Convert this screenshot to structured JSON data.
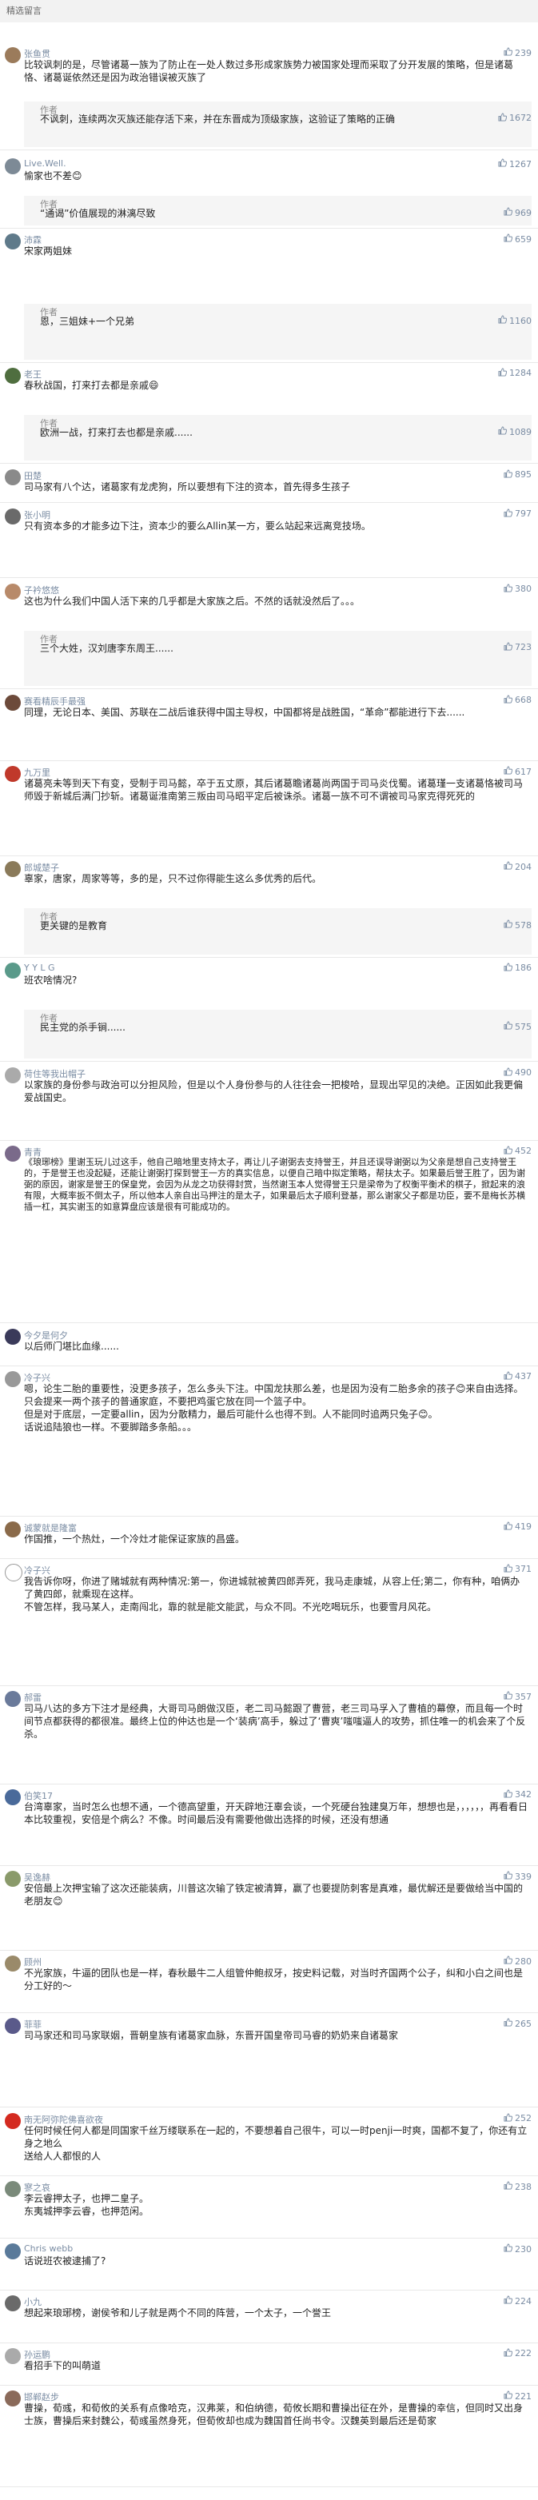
{
  "header": {
    "title": "精选留言"
  },
  "comments": [
    {
      "name": "张鱼贯",
      "likes": "239",
      "avatar_color": "#9b7b5b",
      "text": "比较讽刺的是，尽管诸葛一族为了防止在一处人数过多形成家族势力被国家处理而采取了分开发展的策略，但是诸葛恪、诸葛诞依然还是因为政治错误被灭族了",
      "reply": {
        "label": "作者",
        "text": "不讽刺，连续两次灭族还能存活下来，并在东晋成为顶级家族，这验证了策略的正确",
        "likes": "1672"
      }
    },
    {
      "name": "Live.Well.",
      "likes": "1267",
      "avatar_color": "#7d8a96",
      "text": "愉家也不差😊",
      "reply": {
        "label": "作者",
        "text": "“通谒”价值展现的淋漓尽致",
        "likes": "969"
      }
    },
    {
      "name": "沛霖",
      "likes": "659",
      "avatar_color": "#5f7a8a",
      "text": "宋家两姐妹",
      "reply": {
        "label": "作者",
        "text": "恩，三姐妹+一个兄弟",
        "likes": "1160"
      }
    },
    {
      "name": "老王",
      "likes": "1284",
      "avatar_color": "#4f6e3f",
      "text": "春秋战国，打来打去都是亲戚😄",
      "reply": {
        "label": "作者",
        "text": "欧洲一战，打来打去也都是亲戚......",
        "likes": "1089"
      }
    },
    {
      "name": "田楚",
      "likes": "895",
      "avatar_color": "#8a8a8a",
      "text": "司马家有八个达，诸葛家有龙虎狗，所以要想有下注的资本，首先得多生孩子",
      "reply": null
    },
    {
      "name": "张小明",
      "likes": "797",
      "avatar_color": "#6a6a6a",
      "text": "只有资本多的才能多边下注，资本少的要么Allin某一方，要么站起来远离竞技场。",
      "reply": null
    },
    {
      "name": "子衿悠悠",
      "likes": "380",
      "avatar_color": "#b88a6a",
      "text": "这也为什么我们中国人活下来的几乎都是大家族之后。不然的话就没然后了。。。",
      "reply": {
        "label": "作者",
        "text": "三个大姓，汉刘唐李东周王......",
        "likes": "723"
      }
    },
    {
      "name": "赛看精辰手最强",
      "likes": "668",
      "avatar_color": "#6c4a3a",
      "text": "同理，无论日本、美国、苏联在二战后谁获得中国主导权，中国都将是战胜国，“革命”都能进行下去......",
      "reply": null
    },
    {
      "name": "九万里",
      "likes": "617",
      "avatar_color": "#c0392b",
      "text": "诸葛亮未等到天下有变，受制于司马懿，卒于五丈原，其后诸葛瞻诸葛尚两国于司马炎伐蜀。诸葛瑾一支诸葛恪被司马师毁于新城后满门抄斩。诸葛诞淮南第三叛由司马昭平定后被诛杀。诸葛一族不可不谓被司马家克得死死的",
      "reply": null
    },
    {
      "name": "郎城楚子",
      "likes": "204",
      "avatar_color": "#8a7a5a",
      "text": "辜家，唐家，周家等等，多的是，只不过你得能生这么多优秀的后代。",
      "reply": {
        "label": "作者",
        "text": "更关键的是教育",
        "likes": "578"
      }
    },
    {
      "name": "Y Y L G",
      "likes": "186",
      "avatar_color": "#5a9a8a",
      "text": "班农啥情况?",
      "reply": {
        "label": "作者",
        "text": "民主党的杀手锏......",
        "likes": "575"
      }
    },
    {
      "name": "荷住等我出帽子",
      "likes": "490",
      "avatar_color": "#aaaaaa",
      "text": "以家族的身份参与政治可以分担风险，但是以个人身份参与的人往往会一把梭哈，显现出罕见的决绝。正因如此我更偏爱战国史。",
      "reply": null
    },
    {
      "name": "青青",
      "likes": "452",
      "avatar_color": "#7a6a8a",
      "text": "《琅琊榜》里谢玉玩儿过这手，他自己暗地里支持太子，再让儿子谢弼去支持誉王，并且还误导谢弼以为父亲是想自己支持誉王的，于是誉王也没起疑，还能让谢弼打探到誉王一方的真实信息，以便自己暗中拟定策略，帮扶太子。如果最后誉王胜了，因为谢弼的原因，谢家是誉王的保皇党，会因为从龙之功获得封赏，当然谢玉本人觉得誉王只是梁帝为了权衡平衡术的棋子，掀起来的浪有限，大概率扳不倒太子，所以他本人亲自出马押注的是太子，如果最后太子顺利登基，那么谢家父子都是功臣，要不是梅长苏横插一杠，其实谢玉的如意算盘应该是很有可能成功的。",
      "reply": null
    },
    {
      "name": "今夕是何夕",
      "likes": "",
      "avatar_color": "#3a3a5a",
      "text": "以后师门堪比血缘......",
      "reply": null
    },
    {
      "name": "冷子兴",
      "likes": "437",
      "avatar_color": "#999999",
      "text": "嗯，论生二胎的重要性，没更多孩子，怎么多头下注。中国龙扶那么差，也是因为没有二胎多余的孩子😊来自由选择。只会提来一两个孩子的普通家庭，不要把鸡蛋它放在同一个篮子中。\n但是对于底层，一定要allin，因为分散精力，最后可能什么也得不到。人不能同时追两只兔子😊。\n话说追陆狼也一样。不要脚踏多条船。。。",
      "reply": null
    },
    {
      "name": "诚蒙就是隆富",
      "likes": "419",
      "avatar_color": "#8a6a4a",
      "text": "作国推，一个热灶，一个冷灶才能保证家族的昌盛。",
      "reply": null
    },
    {
      "name": "冷子兴",
      "likes": "371",
      "avatar_color": "#ffffff",
      "text": "我告诉你呀，你进了赌城就有两种情况:第一，你进城就被黄四郎弄死，我马走康城，从容上任;第二，你有种，咱俩办了黄四郎，就乘现在这样。\n不管怎样，我马某人，走南闯北，靠的就是能文能武，与众不同。不光吃喝玩乐，也要雪月风花。",
      "reply": null
    },
    {
      "name": "郝雷",
      "likes": "357",
      "avatar_color": "#6a7a9a",
      "text": "司马八达的多方下注才是经典，大哥司马朗做汉臣，老二司马懿跟了曹营，老三司马孚入了曹植的幕僚，而且每一个时间节点都获得的都很准。最终上位的仲达也是一个‘装病’高手，躲过了‘曹爽’嗤嗤逼人的攻势，抓住唯一的机会来了个反杀。",
      "reply": null
    },
    {
      "name": "伯笑17",
      "likes": "342",
      "avatar_color": "#4a6a9a",
      "text": "台湾辜家，当时怎么也想不通，一个德高望重，开天辟地汪辜会谈，一个死硬台独建臭万年，想想也是，，，，，，再看看日本比较重视，安倍是个病么？不像。时间最后没有需要他做出选择的时候，还没有想通",
      "reply": null
    },
    {
      "name": "吴逸赫",
      "likes": "339",
      "avatar_color": "#8a9a6a",
      "text": "安倍最上次押宝输了这次还能装病，川普这次输了铁定被清算，赢了也要提防刺客是真难，最优解还是要做给当中国的老朋友😊",
      "reply": null
    },
    {
      "name": "顾州",
      "likes": "280",
      "avatar_color": "#9a8a6a",
      "text": "不光家族，牛逼的团队也是一样，春秋最牛二人组管仲鲍叔牙，按史料记载，对当时齐国两个公子，纠和小白之间也是分工好的～",
      "reply": null
    },
    {
      "name": "菲菲",
      "likes": "265",
      "avatar_color": "#5a5a8a",
      "text": "司马家还和司马家联姻，晋朝皇族有诸葛家血脉，东晋开国皇帝司马睿的奶奶来自诸葛家",
      "reply": null
    },
    {
      "name": "南无阿弥陀佛喜欲夜",
      "likes": "252",
      "avatar_color": "#d42a20",
      "text": "任何时候任何人都是同国家千丝万缕联系在一起的，不要想着自己很牛，可以一时penji一时爽，国都不复了，你还有立身之地么\n送给人人都恨的人",
      "reply": null
    },
    {
      "name": "寥之哀",
      "likes": "238",
      "avatar_color": "#7a8a7a",
      "text": "李云睿押太子，也押二皇子。\n东夷城押李云睿，也押范闲。",
      "reply": null
    },
    {
      "name": "Chris webb",
      "likes": "230",
      "avatar_color": "#5a7a9a",
      "text": "话说班农被逮捕了?",
      "reply": null
    },
    {
      "name": "小九",
      "likes": "224",
      "avatar_color": "#6a6a6a",
      "text": "想起来琅琊榜，谢侯爷和儿子就是两个不同的阵营，一个太子，一个誉王",
      "reply": null
    },
    {
      "name": "孙运鹏",
      "likes": "222",
      "avatar_color": "#aaaaaa",
      "text": "看招手下的叫萌道",
      "reply": null
    },
    {
      "name": "邯郸赵步",
      "likes": "221",
      "avatar_color": "#8a6a5a",
      "text": "曹操，荀彧，和荀攸的关系有点像哈克，汉弗莱，和伯纳德，荀攸长期和曹操出征在外，是曹操的幸信，但同时又出身士族，曹操后来封魏公，荀彧虽然身死，但荀攸却也成为魏国首任尚书令。汉魏英到最后还是荀家",
      "reply": null
    }
  ]
}
